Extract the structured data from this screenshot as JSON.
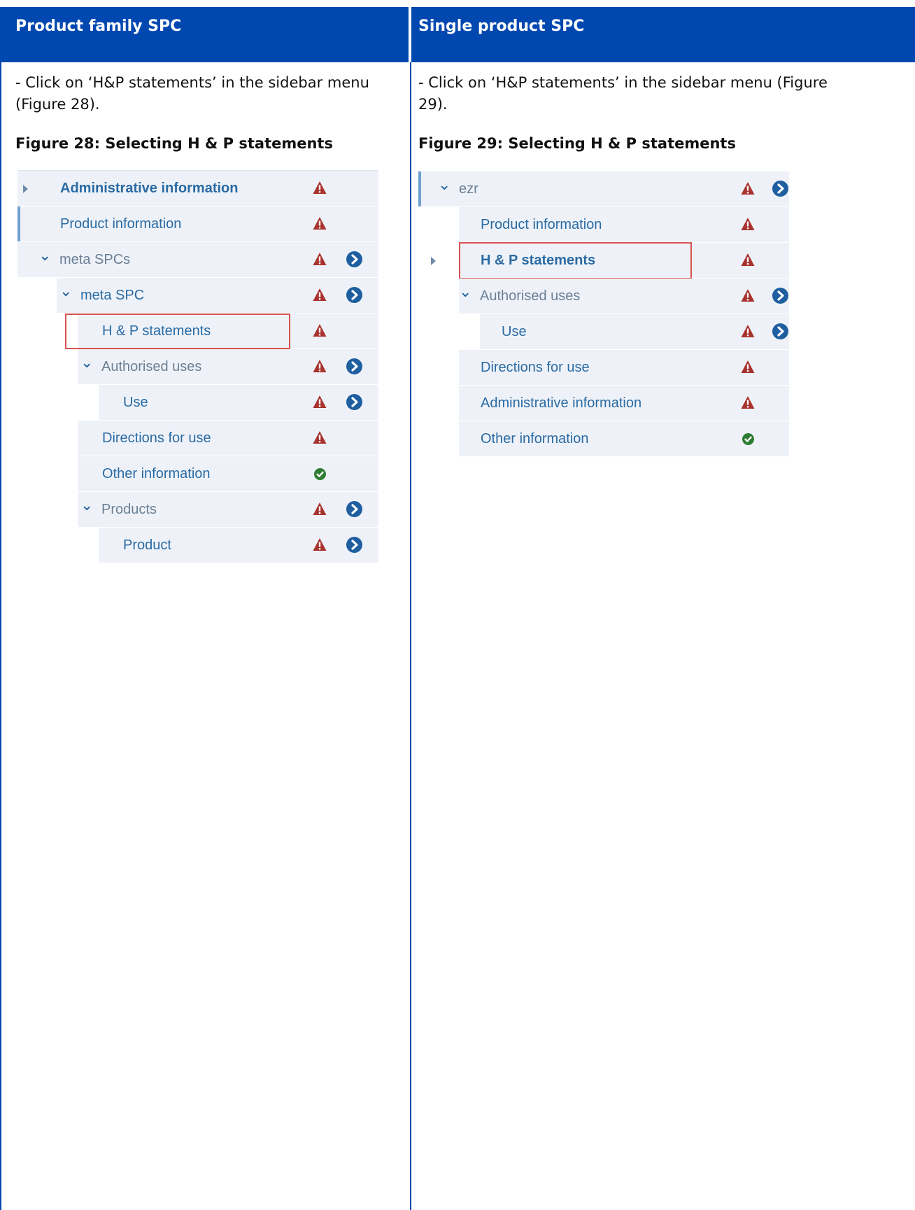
{
  "header": {
    "left_title": "Product family SPC",
    "right_title": "Single product SPC"
  },
  "left": {
    "intro": "- Click on ‘H&P statements’ in the sidebar menu (Figure 28).",
    "caption": "Figure 28: Selecting H & P statements",
    "tree": [
      {
        "label": "Administrative information",
        "status": "warning",
        "nav": false,
        "level": 0,
        "expander": "triangle",
        "bold": true,
        "grey": false
      },
      {
        "label": "Product information",
        "status": "warning",
        "nav": false,
        "level": 0,
        "expander": "none",
        "bold": false,
        "grey": false,
        "selected": true
      },
      {
        "label": "meta SPCs",
        "status": "warning",
        "nav": true,
        "level": 0,
        "expander": "chevron",
        "bold": false,
        "grey": true
      },
      {
        "label": "meta SPC",
        "status": "warning",
        "nav": true,
        "level": 1,
        "expander": "chevron",
        "bold": false,
        "grey": false
      },
      {
        "label": "H & P statements",
        "status": "warning",
        "nav": false,
        "level": 2,
        "expander": "none",
        "bold": false,
        "grey": false,
        "highlighted": true
      },
      {
        "label": "Authorised uses",
        "status": "warning",
        "nav": true,
        "level": 2,
        "expander": "chevron",
        "bold": false,
        "grey": true
      },
      {
        "label": "Use",
        "status": "warning",
        "nav": true,
        "level": 3,
        "expander": "none",
        "bold": false,
        "grey": false
      },
      {
        "label": "Directions for use",
        "status": "warning",
        "nav": false,
        "level": 2,
        "expander": "none",
        "bold": false,
        "grey": false
      },
      {
        "label": "Other information",
        "status": "ok",
        "nav": false,
        "level": 2,
        "expander": "none",
        "bold": false,
        "grey": false
      },
      {
        "label": "Products",
        "status": "warning",
        "nav": true,
        "level": 2,
        "expander": "chevron",
        "bold": false,
        "grey": true
      },
      {
        "label": "Product",
        "status": "warning",
        "nav": true,
        "level": 3,
        "expander": "none",
        "bold": false,
        "grey": false
      }
    ]
  },
  "right": {
    "intro": "- Click on ‘H&P statements’ in the sidebar menu (Figure 29).",
    "caption": "Figure 29: Selecting H & P statements",
    "tree": [
      {
        "label": "ezr",
        "status": "warning",
        "nav": true,
        "level": 0,
        "expander": "chevron",
        "bold": false,
        "grey": true,
        "selected": true
      },
      {
        "label": "Product information",
        "status": "warning",
        "nav": false,
        "level": 1,
        "expander": "none",
        "bold": false,
        "grey": false
      },
      {
        "label": "H & P statements",
        "status": "warning",
        "nav": false,
        "level": 1,
        "expander": "triangle",
        "bold": true,
        "grey": false,
        "highlighted": true
      },
      {
        "label": "Authorised uses",
        "status": "warning",
        "nav": true,
        "level": 1,
        "expander": "chevron",
        "bold": false,
        "grey": true
      },
      {
        "label": "Use",
        "status": "warning",
        "nav": true,
        "level": 2,
        "expander": "none",
        "bold": false,
        "grey": false
      },
      {
        "label": "Directions for use",
        "status": "warning",
        "nav": false,
        "level": 1,
        "expander": "none",
        "bold": false,
        "grey": false
      },
      {
        "label": "Administrative information",
        "status": "warning",
        "nav": false,
        "level": 1,
        "expander": "none",
        "bold": false,
        "grey": false
      },
      {
        "label": "Other information",
        "status": "ok",
        "nav": false,
        "level": 1,
        "expander": "none",
        "bold": false,
        "grey": false
      }
    ]
  },
  "colors": {
    "header_bg": "#0047b0",
    "warning": "#a8322d",
    "nav": "#1f5fa0",
    "ok": "#2e7d32",
    "highlight": "#d9534f"
  }
}
